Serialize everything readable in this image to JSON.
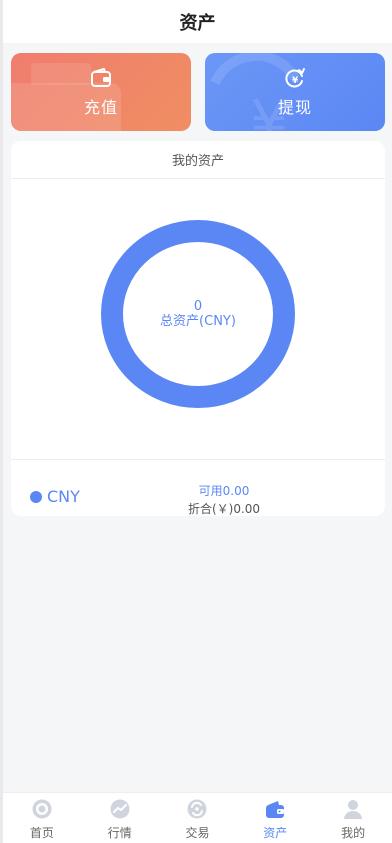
{
  "header": {
    "title": "资产"
  },
  "actions": {
    "recharge_label": "充值",
    "withdraw_label": "提现"
  },
  "assets": {
    "title": "我的资产",
    "total_value": "0",
    "total_label": "总资产(CNY)",
    "currency": "CNY",
    "available": "可用0.00",
    "converted": "折合(￥)0.00"
  },
  "nav": {
    "items": [
      {
        "label": "首页",
        "icon": "home-icon"
      },
      {
        "label": "行情",
        "icon": "market-icon"
      },
      {
        "label": "交易",
        "icon": "trade-icon"
      },
      {
        "label": "资产",
        "icon": "wallet-icon"
      },
      {
        "label": "我的",
        "icon": "user-icon"
      }
    ],
    "active_index": 3
  },
  "colors": {
    "accent": "#5b87f4",
    "recharge": "#f07d6f",
    "withdraw": "#5b87f4"
  }
}
